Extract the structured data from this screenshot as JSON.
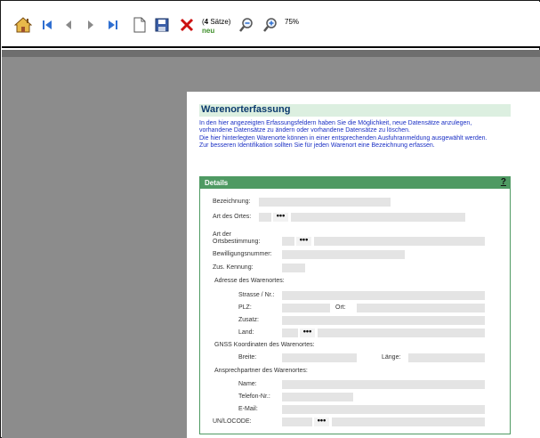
{
  "toolbar": {
    "buttons": [
      {
        "name": "home-button",
        "icon": "home-icon"
      },
      {
        "name": "first-record-button",
        "icon": "first-icon"
      },
      {
        "name": "previous-record-button",
        "icon": "previous-icon"
      },
      {
        "name": "next-record-button",
        "icon": "next-icon"
      },
      {
        "name": "last-record-button",
        "icon": "last-icon"
      },
      {
        "name": "new-record-button",
        "icon": "new-document-icon"
      },
      {
        "name": "save-button",
        "icon": "save-icon"
      },
      {
        "name": "delete-button",
        "icon": "delete-x-icon"
      },
      {
        "name": "zoom-out-button",
        "icon": "zoom-out-icon"
      },
      {
        "name": "zoom-in-button",
        "icon": "zoom-in-icon"
      }
    ],
    "record_count_prefix": "(",
    "record_count": "4",
    "record_count_suffix": " Sätze)",
    "status": "neu",
    "zoom": "75%"
  },
  "colors": {
    "accent_green": "#4f9a63",
    "title_blue": "#0b3a6d",
    "intro_blue": "#1a2fc4",
    "delete_red": "#cc1111"
  },
  "page": {
    "title": "Warenorterfassung",
    "intro_lines": [
      "In den hier angezeigten Erfassungsfeldern haben Sie die Möglichkeit, neue Datensätze anzulegen,",
      "vorhandene Datensätze zu ändern oder vorhandene Datensätze zu löschen.",
      "Die hier hinterlegten Warenorte können in einer entsprechenden Ausfuhranmeldung ausgewählt werden.",
      "Zur besseren Identifikation sollten Sie für jeden Warenort eine Bezeichnung erfassen."
    ]
  },
  "details": {
    "header": "Details",
    "help": "?",
    "labels": {
      "bezeichnung": "Bezeichnung:",
      "art_des_ortes": "Art des Ortes:",
      "art_der": "Art der",
      "ortsbestimmung": "Ortsbestimmung:",
      "bewilligungsnummer": "Bewilligungsnummer:",
      "zus_kennung": "Zus. Kennung:",
      "adresse_section": "Adresse des Warenortes:",
      "strasse": "Strasse / Nr.:",
      "plz": "PLZ:",
      "ort": "Ort:",
      "zusatz": "Zusatz:",
      "land": "Land:",
      "gnss_section": "GNSS Koordinaten des Warenortes:",
      "breite": "Breite:",
      "laenge": "Länge:",
      "ansprechpartner_section": "Ansprechpartner des Warenortes:",
      "name": "Name:",
      "telefon": "Telefon-Nr.:",
      "email": "E-Mail:",
      "unlocode": "UN/LOCODE:"
    },
    "lookup_button": "•••"
  }
}
